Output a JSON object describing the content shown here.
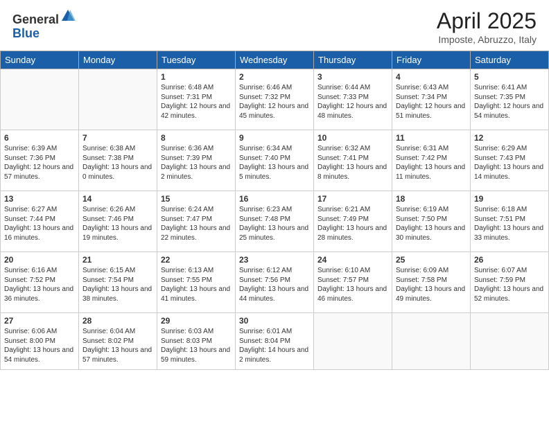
{
  "header": {
    "logo_general": "General",
    "logo_blue": "Blue",
    "title": "April 2025",
    "location": "Imposte, Abruzzo, Italy"
  },
  "days_of_week": [
    "Sunday",
    "Monday",
    "Tuesday",
    "Wednesday",
    "Thursday",
    "Friday",
    "Saturday"
  ],
  "weeks": [
    [
      {
        "day": "",
        "empty": true
      },
      {
        "day": "",
        "empty": true
      },
      {
        "day": "1",
        "sunrise": "6:48 AM",
        "sunset": "7:31 PM",
        "daylight": "12 hours and 42 minutes."
      },
      {
        "day": "2",
        "sunrise": "6:46 AM",
        "sunset": "7:32 PM",
        "daylight": "12 hours and 45 minutes."
      },
      {
        "day": "3",
        "sunrise": "6:44 AM",
        "sunset": "7:33 PM",
        "daylight": "12 hours and 48 minutes."
      },
      {
        "day": "4",
        "sunrise": "6:43 AM",
        "sunset": "7:34 PM",
        "daylight": "12 hours and 51 minutes."
      },
      {
        "day": "5",
        "sunrise": "6:41 AM",
        "sunset": "7:35 PM",
        "daylight": "12 hours and 54 minutes."
      }
    ],
    [
      {
        "day": "6",
        "sunrise": "6:39 AM",
        "sunset": "7:36 PM",
        "daylight": "12 hours and 57 minutes."
      },
      {
        "day": "7",
        "sunrise": "6:38 AM",
        "sunset": "7:38 PM",
        "daylight": "13 hours and 0 minutes."
      },
      {
        "day": "8",
        "sunrise": "6:36 AM",
        "sunset": "7:39 PM",
        "daylight": "13 hours and 2 minutes."
      },
      {
        "day": "9",
        "sunrise": "6:34 AM",
        "sunset": "7:40 PM",
        "daylight": "13 hours and 5 minutes."
      },
      {
        "day": "10",
        "sunrise": "6:32 AM",
        "sunset": "7:41 PM",
        "daylight": "13 hours and 8 minutes."
      },
      {
        "day": "11",
        "sunrise": "6:31 AM",
        "sunset": "7:42 PM",
        "daylight": "13 hours and 11 minutes."
      },
      {
        "day": "12",
        "sunrise": "6:29 AM",
        "sunset": "7:43 PM",
        "daylight": "13 hours and 14 minutes."
      }
    ],
    [
      {
        "day": "13",
        "sunrise": "6:27 AM",
        "sunset": "7:44 PM",
        "daylight": "13 hours and 16 minutes."
      },
      {
        "day": "14",
        "sunrise": "6:26 AM",
        "sunset": "7:46 PM",
        "daylight": "13 hours and 19 minutes."
      },
      {
        "day": "15",
        "sunrise": "6:24 AM",
        "sunset": "7:47 PM",
        "daylight": "13 hours and 22 minutes."
      },
      {
        "day": "16",
        "sunrise": "6:23 AM",
        "sunset": "7:48 PM",
        "daylight": "13 hours and 25 minutes."
      },
      {
        "day": "17",
        "sunrise": "6:21 AM",
        "sunset": "7:49 PM",
        "daylight": "13 hours and 28 minutes."
      },
      {
        "day": "18",
        "sunrise": "6:19 AM",
        "sunset": "7:50 PM",
        "daylight": "13 hours and 30 minutes."
      },
      {
        "day": "19",
        "sunrise": "6:18 AM",
        "sunset": "7:51 PM",
        "daylight": "13 hours and 33 minutes."
      }
    ],
    [
      {
        "day": "20",
        "sunrise": "6:16 AM",
        "sunset": "7:52 PM",
        "daylight": "13 hours and 36 minutes."
      },
      {
        "day": "21",
        "sunrise": "6:15 AM",
        "sunset": "7:54 PM",
        "daylight": "13 hours and 38 minutes."
      },
      {
        "day": "22",
        "sunrise": "6:13 AM",
        "sunset": "7:55 PM",
        "daylight": "13 hours and 41 minutes."
      },
      {
        "day": "23",
        "sunrise": "6:12 AM",
        "sunset": "7:56 PM",
        "daylight": "13 hours and 44 minutes."
      },
      {
        "day": "24",
        "sunrise": "6:10 AM",
        "sunset": "7:57 PM",
        "daylight": "13 hours and 46 minutes."
      },
      {
        "day": "25",
        "sunrise": "6:09 AM",
        "sunset": "7:58 PM",
        "daylight": "13 hours and 49 minutes."
      },
      {
        "day": "26",
        "sunrise": "6:07 AM",
        "sunset": "7:59 PM",
        "daylight": "13 hours and 52 minutes."
      }
    ],
    [
      {
        "day": "27",
        "sunrise": "6:06 AM",
        "sunset": "8:00 PM",
        "daylight": "13 hours and 54 minutes."
      },
      {
        "day": "28",
        "sunrise": "6:04 AM",
        "sunset": "8:02 PM",
        "daylight": "13 hours and 57 minutes."
      },
      {
        "day": "29",
        "sunrise": "6:03 AM",
        "sunset": "8:03 PM",
        "daylight": "13 hours and 59 minutes."
      },
      {
        "day": "30",
        "sunrise": "6:01 AM",
        "sunset": "8:04 PM",
        "daylight": "14 hours and 2 minutes."
      },
      {
        "day": "",
        "empty": true
      },
      {
        "day": "",
        "empty": true
      },
      {
        "day": "",
        "empty": true
      }
    ]
  ]
}
